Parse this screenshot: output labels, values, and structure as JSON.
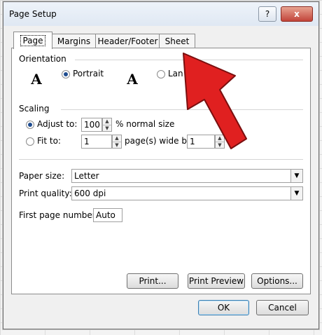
{
  "dialog": {
    "title": "Page Setup",
    "help_label": "?",
    "close_label": "x"
  },
  "tabs": [
    {
      "label": "Page"
    },
    {
      "label": "Margins"
    },
    {
      "label": "Header/Footer"
    },
    {
      "label": "Sheet"
    }
  ],
  "orientation": {
    "label": "Orientation",
    "portrait_icon": "A",
    "portrait_label": "Portrait",
    "landscape_icon": "A",
    "landscape_label": "Lan",
    "selected": "portrait"
  },
  "scaling": {
    "label": "Scaling",
    "adjust_label": "Adjust to:",
    "adjust_value": "100",
    "adjust_suffix": "% normal size",
    "fit_label": "Fit to:",
    "fit_pages_value": "1",
    "pages_wide_label": "page(s) wide by",
    "fit_tall_value": "1"
  },
  "paper": {
    "size_label": "Paper size:",
    "size_value": "Letter",
    "quality_label": "Print quality:",
    "quality_value": "600 dpi",
    "first_page_label": "First page number:",
    "first_page_value": "Auto"
  },
  "buttons": {
    "print": "Print...",
    "print_preview": "Print Preview",
    "options": "Options...",
    "ok": "OK",
    "cancel": "Cancel"
  },
  "annotation": {
    "arrow_color": "#e02020"
  }
}
